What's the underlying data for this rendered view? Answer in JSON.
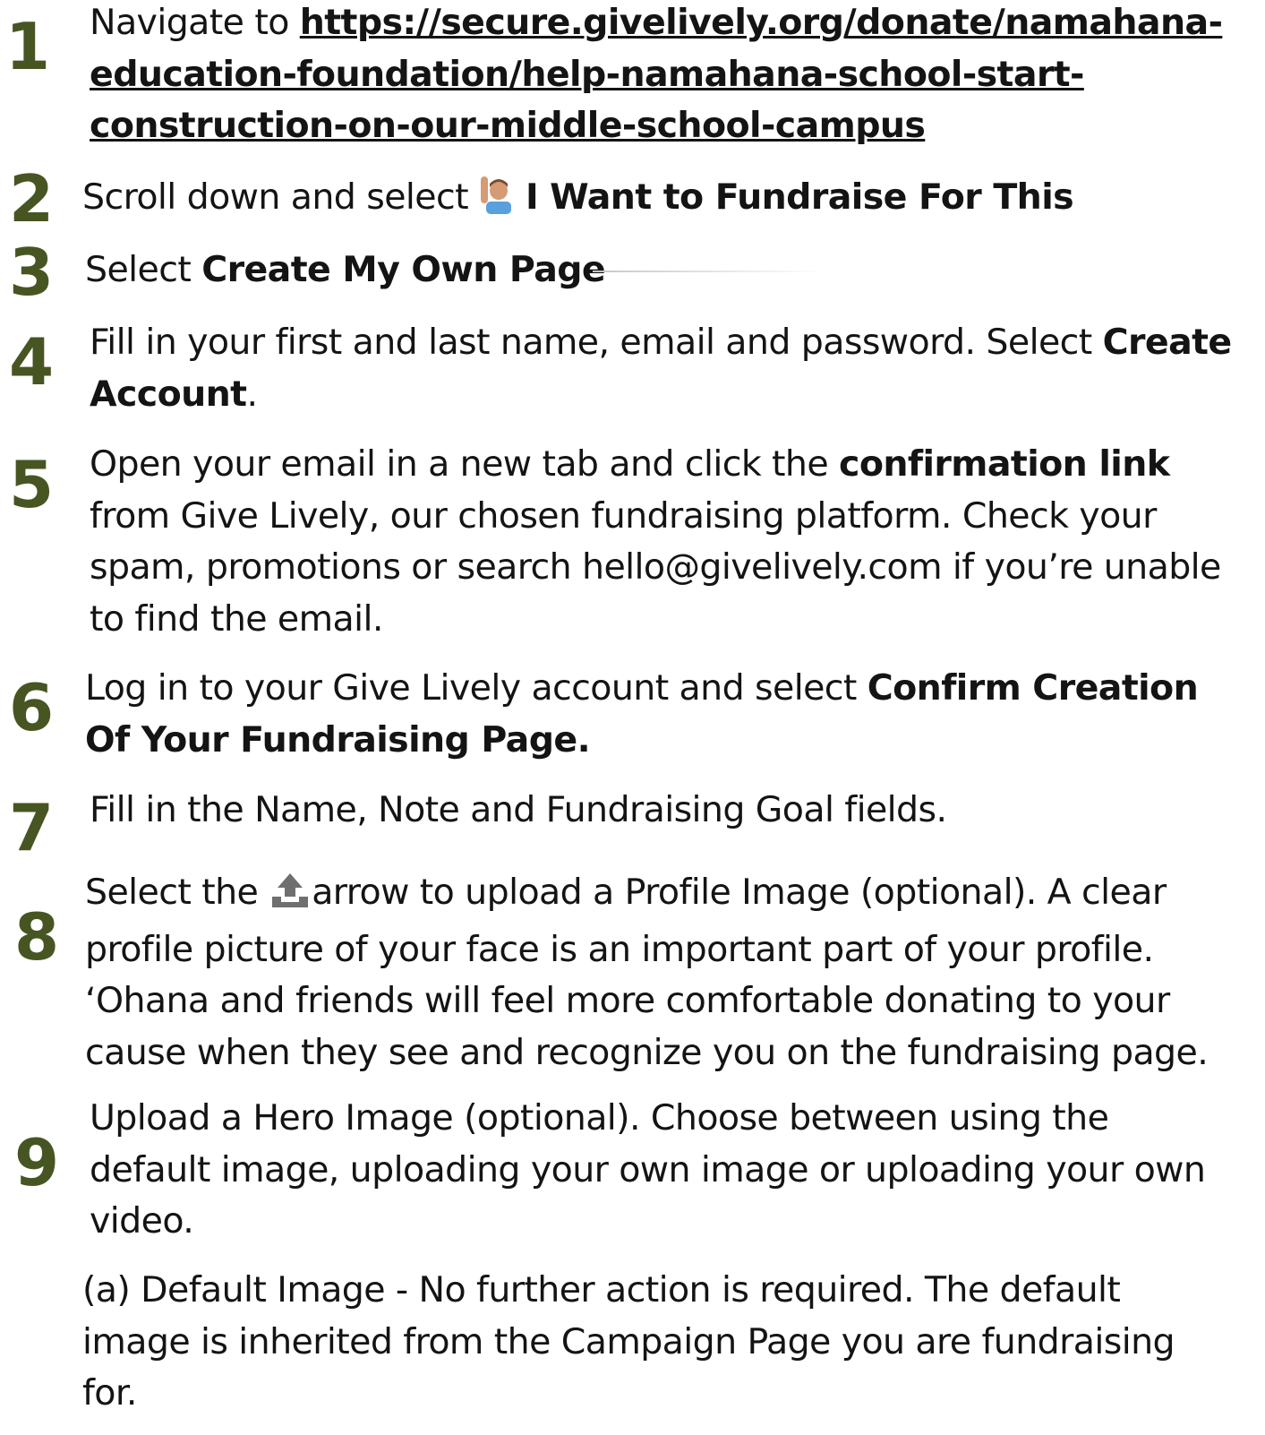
{
  "steps": [
    {
      "number": "1",
      "parts": {
        "a": "Navigate to ",
        "link_line1": "https://secure.givelively.org/donate/namahana-",
        "link_line2": "education-foundation/help-namahana-school-start-",
        "link_line3": "construction-on-our-middle-school-campus"
      }
    },
    {
      "number": "2",
      "parts": {
        "a": "Scroll down and select ",
        "icon": "person-raising-hand-icon",
        "b": "I Want to Fundraise For This"
      }
    },
    {
      "number": "3",
      "parts": {
        "a": "Select ",
        "b": "Create My Own Page"
      }
    },
    {
      "number": "4",
      "parts": {
        "a": "Fill in your first and last name, email and password. Select ",
        "b1": "Create",
        "b2": "Account",
        "c": "."
      }
    },
    {
      "number": "5",
      "parts": {
        "a": "Open your email in a new tab and click the ",
        "b": "confirmation link",
        "line2": "from Give Lively, our chosen fundraising platform. Check your",
        "line3": "spam, promotions or search hello@givelively.com if you’re unable",
        "line4": "to find the email."
      }
    },
    {
      "number": "6",
      "parts": {
        "a": "Log in to your Give Lively account and select ",
        "b1": "Confirm Creation",
        "b2": "Of Your Fundraising Page."
      }
    },
    {
      "number": "7",
      "parts": {
        "a": "Fill in the Name, Note and Fundraising Goal fields."
      }
    },
    {
      "number": "8",
      "parts": {
        "a": "Select the ",
        "icon": "upload-arrow-icon",
        "b": "arrow to upload a Profile Image (optional). A clear",
        "line2": "profile picture of your face is an important part of your profile.",
        "line3": "‘Ohana and friends will feel more comfortable donating to your",
        "line4": "cause when they see and recognize you on the fundraising page."
      }
    },
    {
      "number": "9",
      "parts": {
        "line1": "Upload a Hero Image (optional). Choose between using the",
        "line2": "default image, uploading your own image or uploading your own",
        "line3": "video."
      }
    }
  ],
  "sub_note": {
    "line1": "(a) Default Image - No further action is required. The default",
    "line2": "image is inherited from the Campaign Page you are fundraising",
    "line3": "for."
  },
  "colors": {
    "number": "#475522",
    "text": "#141414"
  }
}
